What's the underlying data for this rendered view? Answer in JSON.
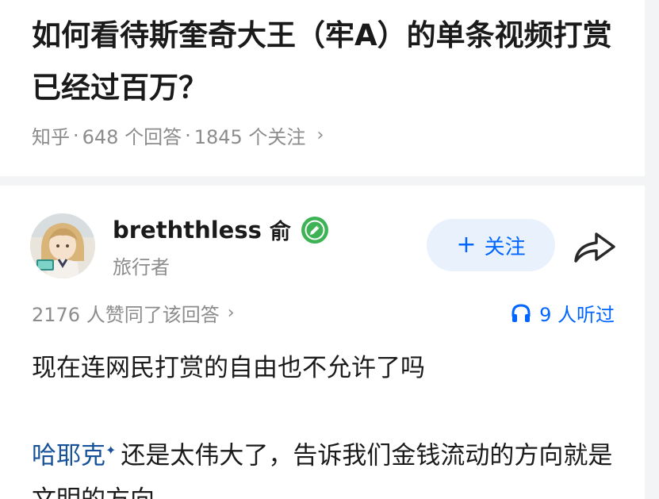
{
  "question": {
    "title": "如何看待斯奎奇大王（牢A）的单条视频打赏已经过百万？",
    "source": "知乎",
    "answers_count": "648 个回答",
    "followers_count": "1845 个关注"
  },
  "answer": {
    "author": {
      "name": "breththless",
      "name_suffix": "俞",
      "headline": "旅行者"
    },
    "follow_label": "关注",
    "upvote_text": "2176 人赞同了该回答",
    "listen_text": "9 人听过",
    "content": {
      "paragraph_1": "现在连网民打赏的自由也不允许了吗",
      "link_text": "哈耶克",
      "paragraph_2_rest": "还是太伟大了，告诉我们金钱流动的方向就是文明的方向"
    }
  },
  "colors": {
    "accent": "#0066ff",
    "follow_bg": "#e9f1fd",
    "link": "#175199",
    "meta_text": "#8c8c8c",
    "badge_green": "#3db355"
  },
  "icons": {
    "badge": "verified-edit-badge-icon",
    "share": "share-arrow-icon",
    "listen": "headphones-icon",
    "chevron": "chevron-right-icon"
  }
}
